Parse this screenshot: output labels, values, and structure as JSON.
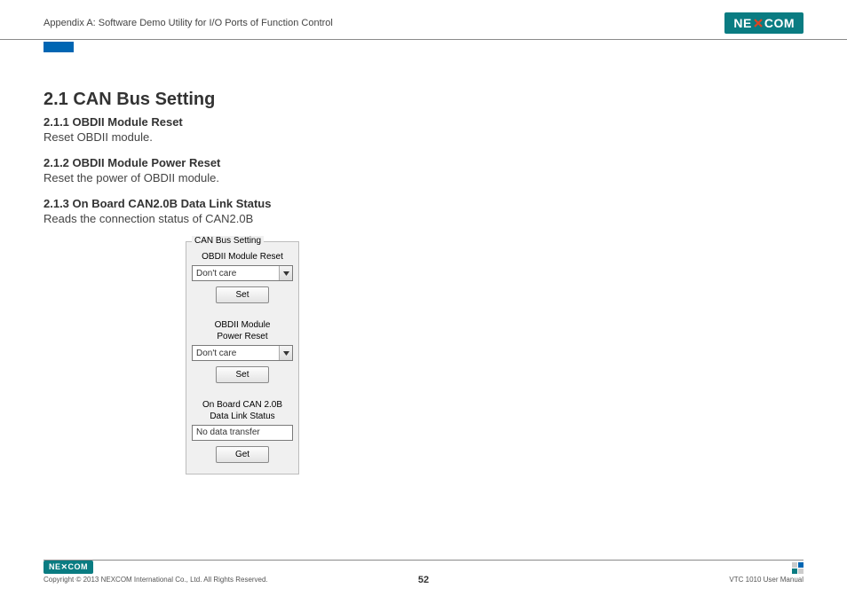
{
  "header": {
    "appendix_title": "Appendix A: Software Demo Utility for I/O Ports of Function Control",
    "logo_text": "NE COM",
    "logo_x": "✕"
  },
  "section": {
    "title": "2.1  CAN Bus Setting",
    "sub1": {
      "heading": "2.1.1  OBDII Module Reset",
      "text": "Reset OBDII module."
    },
    "sub2": {
      "heading": "2.1.2  OBDII Module Power Reset",
      "text": "Reset the power of OBDII module."
    },
    "sub3": {
      "heading": "2.1.3  On Board CAN2.0B Data Link Status",
      "text": "Reads the connection status of CAN2.0B"
    }
  },
  "groupbox": {
    "title": "CAN Bus Setting",
    "field1": {
      "label": "OBDII Module Reset",
      "value": "Don't care",
      "button": "Set"
    },
    "field2": {
      "label_line1": "OBDII Module",
      "label_line2": "Power Reset",
      "value": "Don't care",
      "button": "Set"
    },
    "field3": {
      "label_line1": "On Board CAN 2.0B",
      "label_line2": "Data Link Status",
      "value": "No data transfer",
      "button": "Get"
    }
  },
  "footer": {
    "copyright": "Copyright © 2013 NEXCOM International Co., Ltd. All Rights Reserved.",
    "page": "52",
    "manual": "VTC 1010 User Manual",
    "logo_text": "NE✕COM"
  }
}
